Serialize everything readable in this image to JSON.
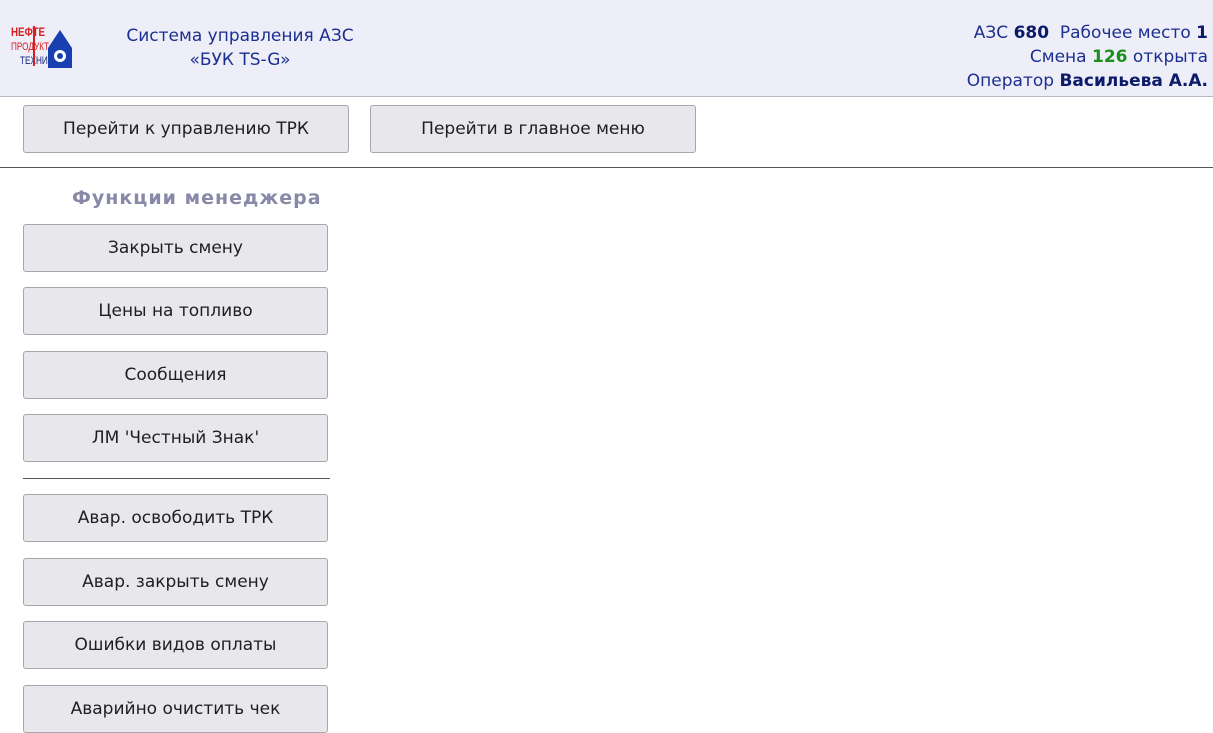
{
  "header": {
    "logo": {
      "lines": [
        "НЕФТЕ",
        "ПРОДУКТ",
        "ТЕХНИКА"
      ],
      "colors": {
        "red": "#d42020",
        "blue": "#1a3fb0",
        "navy": "#14247a"
      }
    },
    "system_title_line1": "Система управления АЗС",
    "system_title_line2": "«БУК TS-G»",
    "station_label": "АЗС",
    "station_number": "680",
    "workplace_label": "Рабочее место",
    "workplace_number": "1",
    "shift_label": "Смена",
    "shift_number": "126",
    "shift_status": "открыта",
    "operator_label": "Оператор",
    "operator_name": "Васильева А.А."
  },
  "nav": {
    "to_trk": "Перейти к управлению ТРК",
    "to_main_menu": "Перейти в главное меню"
  },
  "manager": {
    "title": "Функции менеджера",
    "buttons": [
      "Закрыть смену",
      "Цены на топливо",
      "Сообщения",
      "ЛМ 'Честный Знак'"
    ],
    "emergency_buttons": [
      "Авар. освободить ТРК",
      "Авар. закрыть смену",
      "Ошибки видов оплаты",
      "Аварийно очистить чек"
    ]
  },
  "colors": {
    "header_bg": "#eeeef8",
    "title_blue": "#1a2f8f",
    "shift_green": "#1a8f1a",
    "section_title": "#8888a8",
    "button_bg": "#e8e8ec"
  }
}
